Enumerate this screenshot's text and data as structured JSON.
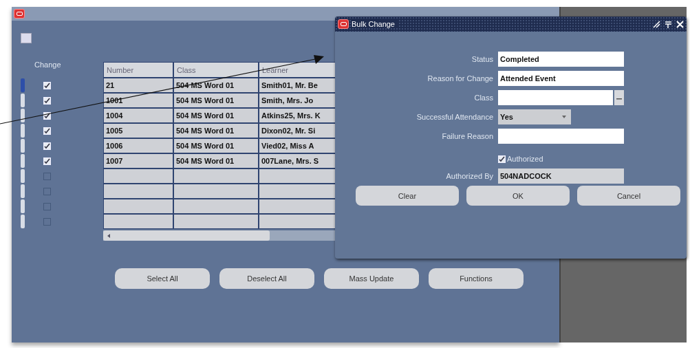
{
  "main_window": {
    "change_label": "Change",
    "columns": [
      "Number",
      "Class",
      "Learner"
    ],
    "rows": [
      {
        "checked": true,
        "current": true,
        "cells": [
          "21",
          "504 MS Word 01",
          "Smith01, Mr. Be"
        ]
      },
      {
        "checked": true,
        "current": false,
        "cells": [
          "1001",
          "504 MS Word 01",
          "Smith, Mrs. Jo"
        ]
      },
      {
        "checked": true,
        "current": false,
        "cells": [
          "1004",
          "504 MS Word 01",
          "Atkins25, Mrs. K"
        ]
      },
      {
        "checked": true,
        "current": false,
        "cells": [
          "1005",
          "504 MS Word 01",
          "Dixon02, Mr. Si"
        ]
      },
      {
        "checked": true,
        "current": false,
        "cells": [
          "1006",
          "504 MS Word 01",
          "Vied02, Miss A"
        ]
      },
      {
        "checked": true,
        "current": false,
        "cells": [
          "1007",
          "504 MS Word 01",
          "007Lane, Mrs. S"
        ]
      },
      {
        "checked": false,
        "current": false,
        "cells": []
      },
      {
        "checked": false,
        "current": false,
        "cells": []
      },
      {
        "checked": false,
        "current": false,
        "cells": []
      },
      {
        "checked": false,
        "current": false,
        "cells": []
      }
    ],
    "buttons": [
      "Select All",
      "Deselect All",
      "Mass Update",
      "Functions"
    ]
  },
  "dialog": {
    "title": "Bulk Change",
    "fields": [
      {
        "kind": "text",
        "label": "Status",
        "value": "Completed"
      },
      {
        "kind": "text",
        "label": "Reason for Change",
        "value": "Attended Event"
      },
      {
        "kind": "lov",
        "label": "Class"
      },
      {
        "kind": "select",
        "label": "Successful Attendance",
        "value": "Yes"
      },
      {
        "kind": "text",
        "label": "Failure Reason"
      },
      {
        "kind": "checkbox",
        "label": "Authorized",
        "checked": true
      },
      {
        "kind": "readonly",
        "label": "Authorized By",
        "value": "504NADCOCK"
      }
    ],
    "buttons": [
      "Clear",
      "OK",
      "Cancel"
    ]
  }
}
